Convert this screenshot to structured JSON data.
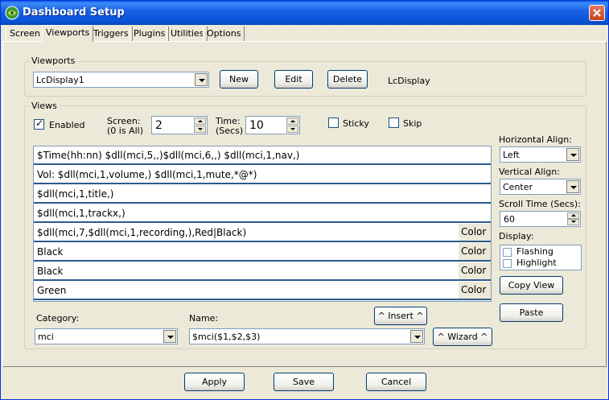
{
  "window": {
    "title": "Dashboard Setup"
  },
  "tabs": [
    "Screen",
    "Viewports",
    "Triggers",
    "Plugins",
    "Utilities",
    "Options"
  ],
  "viewports": {
    "legend": "Viewports",
    "selected": "LcDisplay1",
    "new_label": "New",
    "edit_label": "Edit",
    "delete_label": "Delete",
    "type_text": "LcDisplay"
  },
  "views": {
    "legend": "Views",
    "enabled_label": "Enabled",
    "screen_label_1": "Screen:",
    "screen_label_2": "(0 is All)",
    "screen_value": "2",
    "time_label_1": "Time:",
    "time_label_2": "(Secs)",
    "time_value": "10",
    "sticky_label": "Sticky",
    "skip_label": "Skip",
    "rows": [
      {
        "text": "$Time(hh:nn) $dll(mci,5,,)$dll(mci,6,,) $dll(mci,1,nav,)",
        "color": ""
      },
      {
        "text": "Vol: $dll(mci,1,volume,) $dll(mci,1,mute,*@*)",
        "color": ""
      },
      {
        "text": "$dll(mci,1,title,)",
        "color": ""
      },
      {
        "text": "$dll(mci,1,trackx,)",
        "color": ""
      },
      {
        "text": "$dll(mci,7,$dll(mci,1,recording,),Red|Black)",
        "color": "Color"
      },
      {
        "text": "Black",
        "color": "Color"
      },
      {
        "text": "Black",
        "color": "Color"
      },
      {
        "text": "Green",
        "color": "Color"
      }
    ],
    "category_label": "Category:",
    "category_value": "mci",
    "name_label": "Name:",
    "name_value": "$mci($1,$2,$3)",
    "insert_label": "^ Insert ^",
    "wizard_label": "^ Wizard ^"
  },
  "right_panel": {
    "halign_label": "Horizontal Align:",
    "halign_value": "Left",
    "valign_label": "Vertical Align:",
    "valign_value": "Center",
    "scroll_label": "Scroll Time (Secs):",
    "scroll_value": "60",
    "display_label": "Display:",
    "flashing_label": "Flashing",
    "highlight_label": "Highlight",
    "copy_view_label": "Copy View",
    "paste_label": "Paste"
  },
  "footer": {
    "apply_label": "Apply",
    "save_label": "Save",
    "cancel_label": "Cancel"
  },
  "icons": {
    "app": "app-logo-icon",
    "close": "close-icon",
    "dropdown": "chevron-down-icon"
  },
  "colors": {
    "title_bar": "#0853d6",
    "face": "#ece9d8",
    "row_border": "#2c5b8c"
  }
}
